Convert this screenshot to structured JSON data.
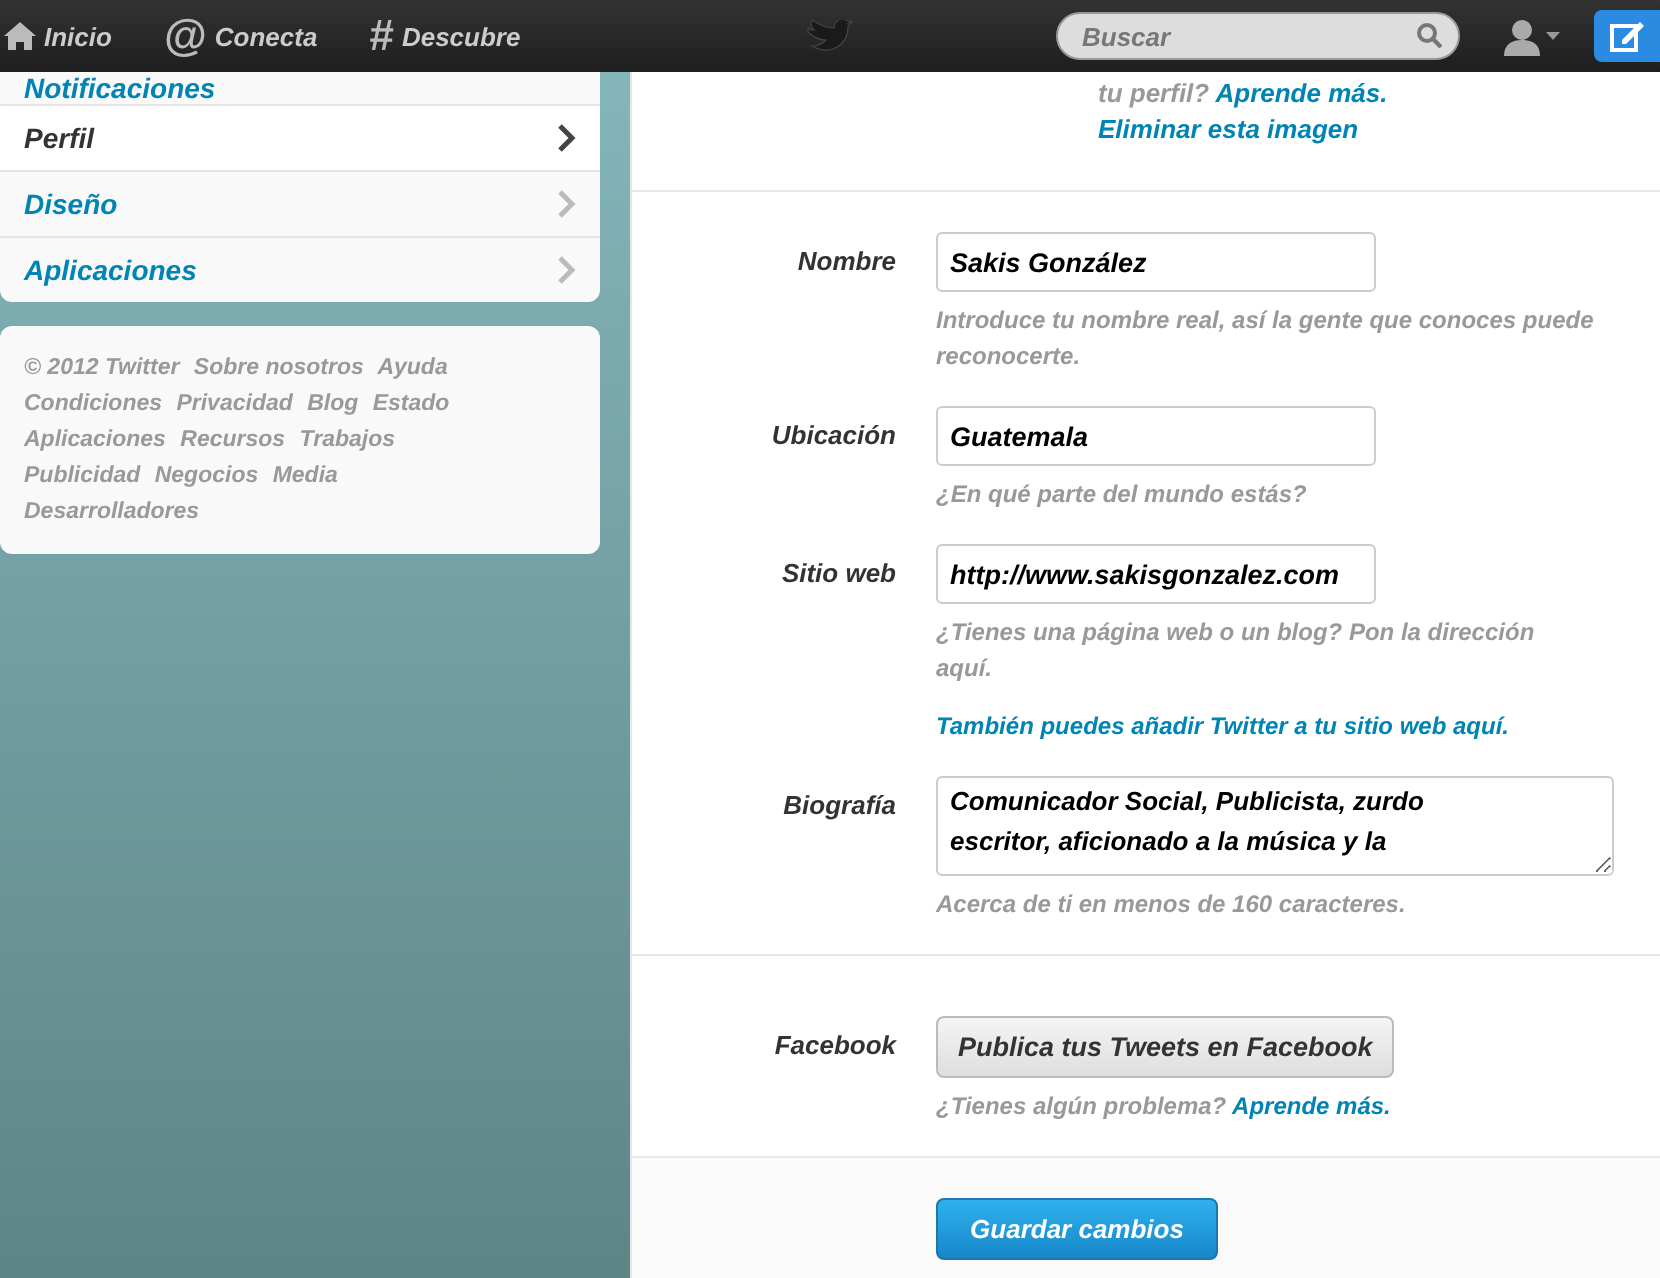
{
  "top_nav": {
    "items": [
      {
        "kind": "home",
        "label": "Inicio"
      },
      {
        "kind": "glyph",
        "glyph": "@",
        "label": "Conecta"
      },
      {
        "kind": "glyph",
        "glyph": "#",
        "label": "Descubre"
      }
    ],
    "search": {
      "placeholder": "Buscar"
    }
  },
  "settings_menu": [
    {
      "label": "Notificaciones",
      "selected": false
    },
    {
      "label": "Perfil",
      "selected": true
    },
    {
      "label": "Diseño",
      "selected": false
    },
    {
      "label": "Aplicaciones",
      "selected": false
    }
  ],
  "footer_links": [
    "© 2012 Twitter",
    "Sobre nosotros",
    "Ayuda",
    "Condiciones",
    "Privacidad",
    "Blog",
    "Estado",
    "Aplicaciones",
    "Recursos",
    "Trabajos",
    "Publicidad",
    "Negocios",
    "Media",
    "Desarrolladores"
  ],
  "profile_form": {
    "photo_note": {
      "text": "tu perfil?",
      "link": "Aprende más."
    },
    "remove_image_link": "Eliminar esta imagen",
    "fields": [
      {
        "kind": "input",
        "label": "Nombre",
        "value": "Sakis González",
        "hint": "Introduce tu nombre real, así la gente que conoces puede reconocerte."
      },
      {
        "kind": "input",
        "label": "Ubicación",
        "value": "Guatemala",
        "hint": "¿En qué parte del mundo estás?"
      },
      {
        "kind": "input",
        "label": "Sitio web",
        "value": "http://www.sakisgonzalez.com",
        "hint": "¿Tienes una página web o un blog? Pon la dirección aquí.",
        "link": "También puedes añadir Twitter a tu sitio web aquí."
      },
      {
        "kind": "textarea",
        "label": "Biografía",
        "value": "Comunicador Social, Publicista, zurdo escritor, aficionado a la música y la",
        "hint": "Acerca de ti en menos de 160 caracteres."
      }
    ],
    "facebook": {
      "label": "Facebook",
      "button": "Publica tus Tweets en Facebook",
      "hint": "¿Tienes algún problema?",
      "link": "Aprende más."
    },
    "save_button": "Guardar cambios"
  }
}
